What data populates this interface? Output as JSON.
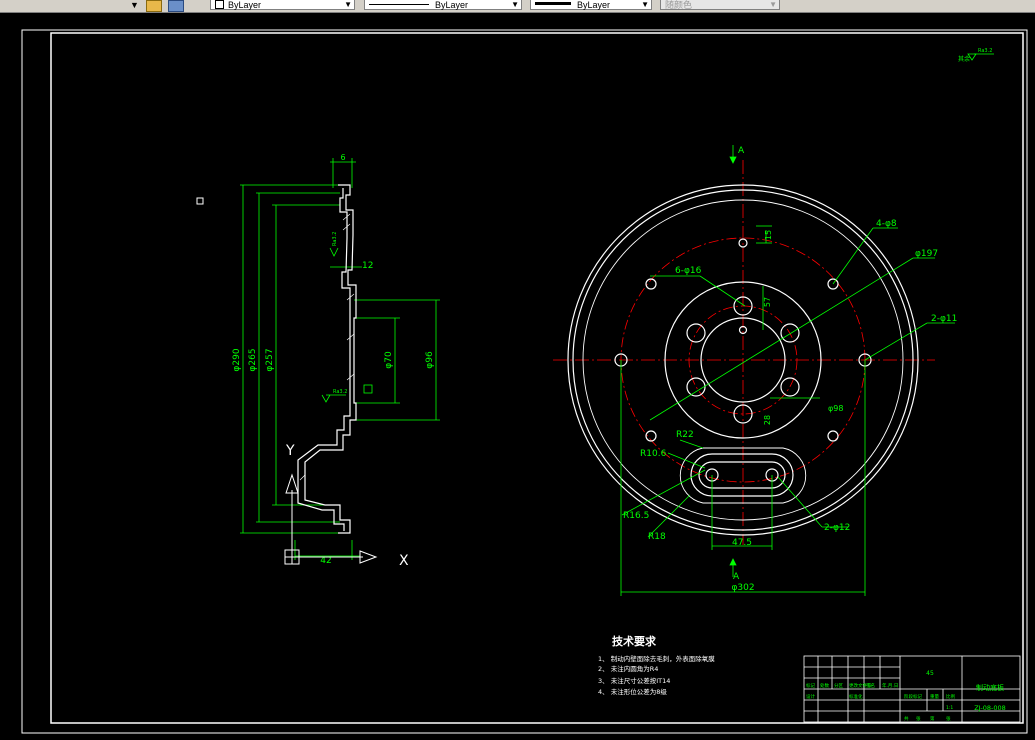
{
  "toolbar": {
    "linetype_value": "ByLayer",
    "lineweight_value": "ByLayer",
    "color_value": "ByLayer",
    "plotstyle_value": "随颜色"
  },
  "drawing": {
    "surface_symbol": "Ra3.2",
    "section_view": {
      "dim_top": "6",
      "dim_12": "12",
      "dim_bottom": "42",
      "dia_290": "φ290",
      "dia_265": "φ265",
      "dia_257": "φ257",
      "dia_70": "φ70",
      "dia_96": "φ96",
      "ra_a": "Ra3.2",
      "ra_b": "Ra3.2",
      "flag": "A",
      "x_label": "X",
      "y_label": "Y"
    },
    "front_view": {
      "section_mark_top": "A",
      "section_mark_bottom": "A",
      "dim_15": "15",
      "dim_57": "57",
      "holes_4": "4-φ8",
      "dia_197": "φ197",
      "holes_6": "6-φ16",
      "holes_2_11": "2-φ11",
      "dia_98": "φ98",
      "dim_28": "28",
      "r22": "R22",
      "r10_6": "R10.6",
      "r16_5": "R16.5",
      "r18": "R18",
      "dim_47_5": "47.5",
      "holes_2_12": "2-φ12",
      "dia_302": "φ302"
    },
    "notes": {
      "title": "技术要求",
      "items": [
        "1、 制动内壁面除去毛刺，外表面除氧膜",
        "2、 未注内圆角为R4",
        "3、 未注尺寸公差按IT14",
        "4、 未注形位公差为8级"
      ]
    },
    "title_block": {
      "quantity": "45",
      "part_name": "制动底板",
      "drawing_no": "ZJ-08-008",
      "labels": [
        "标记",
        "处数",
        "分区",
        "更改文件号",
        "签名",
        "年.月.日"
      ],
      "row2_labels": [
        "设计",
        "标准化",
        "阶段标记",
        "重量",
        "比例"
      ],
      "scale": "1:1",
      "footer": [
        "共",
        "张",
        "第",
        "张"
      ]
    }
  }
}
